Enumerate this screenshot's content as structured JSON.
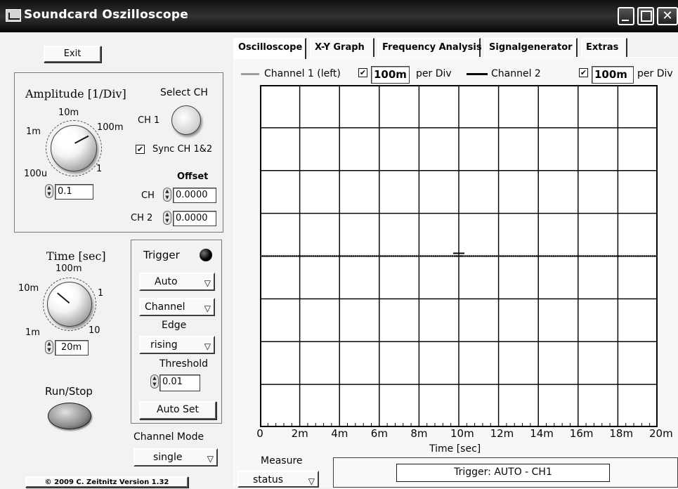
{
  "window": {
    "title": "Soundcard Oszilloscope"
  },
  "left": {
    "exit_label": "Exit",
    "amplitude": {
      "title": "Amplitude [1/Div]",
      "select_ch_label": "Select CH",
      "ch1_label": "CH 1",
      "dial_labels": {
        "top": "10m",
        "left": "1m",
        "right": "100m",
        "bottom_left": "100u",
        "bottom_right": "1"
      },
      "value": "0.1",
      "sync_label": "Sync CH 1&2",
      "sync_checked": true,
      "offset_label": "Offset",
      "offset_ch_label": "CH",
      "offset_ch_value": "0.0000",
      "offset_ch2_label": "CH 2",
      "offset_ch2_value": "0.0000"
    },
    "time": {
      "title": "Time [sec]",
      "dial_labels": {
        "top": "100m",
        "left": "10m",
        "right": "1",
        "bottom_left": "1m",
        "bottom_right": "10"
      },
      "value": "20m"
    },
    "trigger": {
      "title": "Trigger",
      "mode": "Auto",
      "channel": "Channel",
      "edge_label": "Edge",
      "edge": "rising",
      "threshold_label": "Threshold",
      "threshold_value": "0.01",
      "autoset_label": "Auto Set"
    },
    "run_stop_label": "Run/Stop",
    "channel_mode_label": "Channel Mode",
    "channel_mode": "single",
    "copyright": "© 2009  C. Zeitnitz Version 1.32"
  },
  "tabs": [
    {
      "label": "Oscilloscope",
      "active": true
    },
    {
      "label": "X-Y Graph",
      "active": false
    },
    {
      "label": "Frequency Analysis",
      "active": false
    },
    {
      "label": "Signalgenerator",
      "active": false
    },
    {
      "label": "Extras",
      "active": false
    }
  ],
  "legend": {
    "ch1_label": "Channel 1 (left)",
    "ch1_checked": true,
    "ch1_div": "100m",
    "per_div": "per Div",
    "ch2_label": "Channel 2",
    "ch2_checked": true,
    "ch2_div": "100m"
  },
  "chart_data": {
    "type": "line",
    "xlabel": "Time [sec]",
    "x_ticks": [
      "0",
      "2m",
      "4m",
      "6m",
      "8m",
      "10m",
      "12m",
      "14m",
      "16m",
      "18m",
      "20m"
    ],
    "xlim": [
      0,
      0.02
    ],
    "grid": true,
    "divisions_x": 10,
    "divisions_y": 8,
    "series": [
      {
        "name": "Channel 1 (left)",
        "x": [
          0,
          0.02
        ],
        "y": [
          0,
          0
        ]
      }
    ]
  },
  "bottom": {
    "measure_label": "Measure",
    "measure_value": "status",
    "trigger_status": "Trigger: AUTO - CH1"
  }
}
